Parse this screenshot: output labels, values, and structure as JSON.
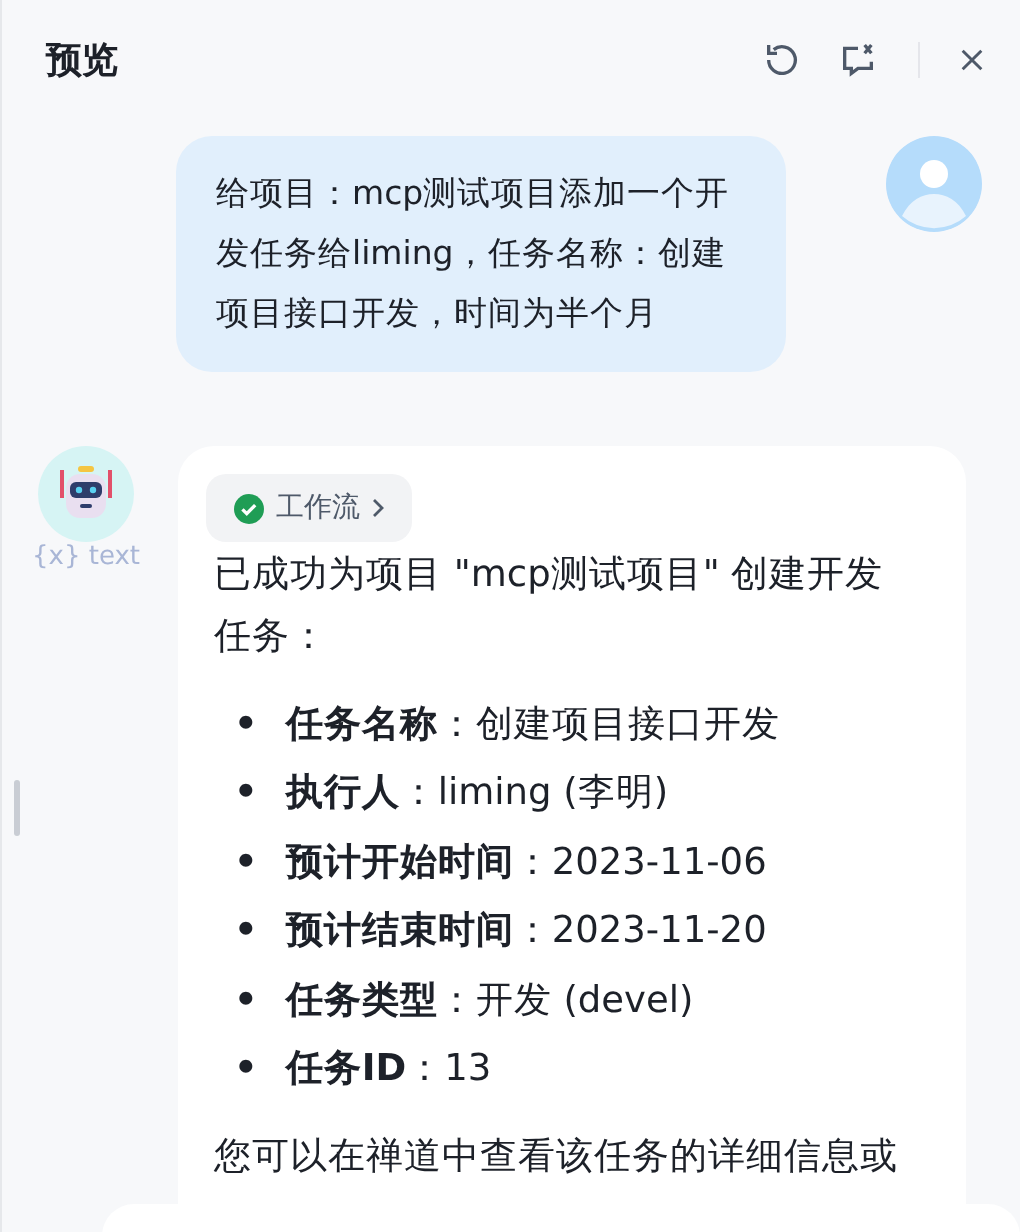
{
  "header": {
    "title": "预览"
  },
  "user_message": {
    "text": "给项目：mcp测试项目添加一个开发任务给liming，任务名称：创建项目接口开发，时间为半个月"
  },
  "bot": {
    "avatar_label": "{x} text",
    "workflow": {
      "label": "工作流",
      "done": true
    },
    "intro": "已成功为项目 \"mcp测试项目\" 创建开发任务：",
    "items": [
      {
        "marker": "•",
        "label": "任务名称",
        "value": "：创建项目接口开发"
      },
      {
        "marker": "•",
        "label": "执行人",
        "value": "：liming (李明)"
      },
      {
        "marker": "•",
        "label": "预计开始时间",
        "value": "：2023-11-06"
      },
      {
        "marker": "•",
        "label": "预计结束时间",
        "value": "：2023-11-20"
      },
      {
        "marker": "•",
        "label": "任务类型",
        "value": "：开发 (devel)"
      },
      {
        "marker": "•",
        "label": "任务ID",
        "value": "：13"
      }
    ],
    "outro": "您可以在禅道中查看该任务的详细信息或"
  }
}
